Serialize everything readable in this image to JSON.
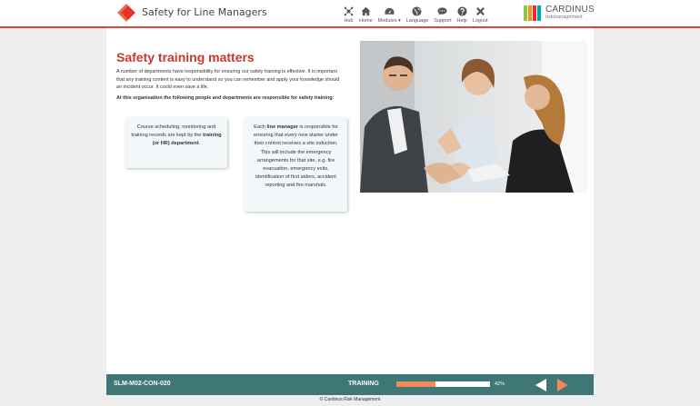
{
  "header": {
    "title": "Safety for Line Managers",
    "accent_color": "#d9473f",
    "nav": [
      {
        "label": "Hub",
        "icon": "hub-icon"
      },
      {
        "label": "Home",
        "icon": "home-icon"
      },
      {
        "label": "Modules ▾",
        "icon": "dashboard-icon"
      },
      {
        "label": "Language",
        "icon": "globe-icon"
      },
      {
        "label": "Support",
        "icon": "chat-icon"
      },
      {
        "label": "Help",
        "icon": "help-icon"
      },
      {
        "label": "Logout",
        "icon": "close-icon"
      }
    ],
    "logo": {
      "name": "CARDINUS",
      "sub": "riskmanagement",
      "bar_colors": [
        "#8dc63f",
        "#f7941d",
        "#e0352b",
        "#00a6b6"
      ]
    }
  },
  "content": {
    "title": "Safety training matters",
    "intro": "A number of departments have responsibility for ensuring our safety training is effective. It is important that any training content is easy to understand so you can remember and apply your knowledge should an incident occur. It could even save a life.",
    "intro_bold": "At this organisation the following people and departments are responsible for safety training:",
    "card1": {
      "pre": "Course scheduling, monitoring and training records are kept by the ",
      "bold": "training (or HR) department",
      "post": "."
    },
    "card2": {
      "pre": "Each ",
      "bold": "line manager",
      "post": " is responsible for ensuring that every new starter under their control receives a site induction. This will include the emergency arrangements for that site, e.g. fire evacuation, emergency exits, identification of first aiders, accident reporting and fire marshals."
    }
  },
  "footer": {
    "code": "SLM-M02-CON-020",
    "section": "TRAINING",
    "progress_percent": 42,
    "progress_label": "42%"
  },
  "copyright": "© Cardinus Risk Management"
}
